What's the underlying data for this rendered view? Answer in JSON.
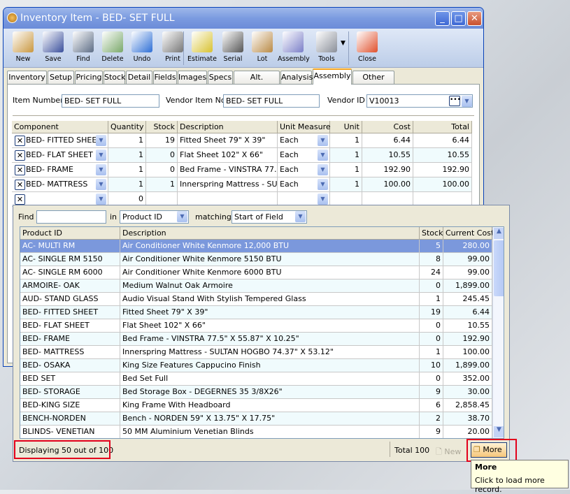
{
  "window": {
    "title": "Inventory Item - BED- SET FULL",
    "controls": [
      "_",
      "□",
      "✕"
    ]
  },
  "toolbar": [
    {
      "label": "New",
      "icon": "new-item-icon",
      "color": "#c9973f"
    },
    {
      "label": "Save",
      "icon": "floppy-disk-icon",
      "color": "#3a4f9c"
    },
    {
      "label": "Find",
      "icon": "binoculars-icon",
      "color": "#5d6d86"
    },
    {
      "label": "Delete",
      "icon": "recycle-bin-icon",
      "color": "#7aa86a"
    },
    {
      "label": "Undo",
      "icon": "undo-arrow-icon",
      "color": "#2e6fd6"
    },
    {
      "label": "Print",
      "icon": "printer-icon",
      "color": "#777777"
    },
    {
      "label": "Estimate",
      "icon": "estimate-icon",
      "color": "#d8c230"
    },
    {
      "label": "Serial",
      "icon": "barcode-icon",
      "color": "#555555"
    },
    {
      "label": "Lot",
      "icon": "lot-box-icon",
      "color": "#b98a45"
    },
    {
      "label": "Assembly",
      "icon": "assembly-icon",
      "color": "#7b7fc8"
    },
    {
      "label": "Tools",
      "icon": "tools-icon",
      "color": "#8a8f99"
    },
    {
      "label": "Close",
      "icon": "close-window-icon",
      "color": "#e0502c"
    }
  ],
  "tabs": [
    "Inventory",
    "Setup",
    "Pricing",
    "Stock",
    "Detail",
    "Fields",
    "Images",
    "Specs",
    "Alt. Vendors",
    "Analysis",
    "Assembly",
    "Other Cost"
  ],
  "active_tab": "Assembly",
  "form": {
    "item_number_label": "Item Number",
    "item_number": "BED- SET FULL",
    "vendor_item_label": "Vendor Item No",
    "vendor_item": "BED- SET FULL",
    "vendor_id_label": "Vendor ID",
    "vendor_id": "V10013"
  },
  "components": {
    "columns": [
      "Component",
      "Quantity",
      "Stock",
      "Description",
      "Unit Measure",
      "Unit",
      "Cost",
      "Total"
    ],
    "rows": [
      [
        "BED- FITTED SHEET",
        "1",
        "19",
        "Fitted Sheet 79\" X 39\"",
        "Each",
        "1",
        "6.44",
        "6.44"
      ],
      [
        "BED- FLAT SHEET",
        "1",
        "0",
        "Flat Sheet 102\" X 66\"",
        "Each",
        "1",
        "10.55",
        "10.55"
      ],
      [
        "BED- FRAME",
        "1",
        "0",
        "Bed Frame - VINSTRA 77.5\" X",
        "Each",
        "1",
        "192.90",
        "192.90"
      ],
      [
        "BED- MATTRESS",
        "1",
        "1",
        "Innerspring Mattress - SULTAN",
        "Each",
        "1",
        "100.00",
        "100.00"
      ],
      [
        "",
        "0",
        "",
        "",
        "",
        "",
        "",
        ""
      ]
    ]
  },
  "lookup": {
    "find_label": "Find",
    "find_value": "",
    "in_label": "in",
    "in_value": "Product ID",
    "matching_label": "matching",
    "matching_value": "Start of Field",
    "columns": [
      "Product ID",
      "Description",
      "Stock",
      "Current Cost"
    ],
    "selected_index": 0,
    "rows": [
      [
        "AC- MULTI RM",
        "Air Conditioner White Kenmore 12,000 BTU",
        "5",
        "280.00"
      ],
      [
        "AC- SINGLE RM 5150",
        "Air Conditioner White Kenmore 5150 BTU",
        "8",
        "99.00"
      ],
      [
        "AC- SINGLE RM 6000",
        "Air Conditioner White Kenmore 6000 BTU",
        "24",
        "99.00"
      ],
      [
        "ARMOIRE- OAK",
        "Medium Walnut Oak Armoire",
        "0",
        "1,899.00"
      ],
      [
        "AUD- STAND GLASS",
        "Audio Visual Stand With Stylish Tempered Glass",
        "1",
        "245.45"
      ],
      [
        "BED- FITTED SHEET",
        "Fitted Sheet 79\" X 39\"",
        "19",
        "6.44"
      ],
      [
        "BED- FLAT SHEET",
        "Flat Sheet 102\" X 66\"",
        "0",
        "10.55"
      ],
      [
        "BED- FRAME",
        "Bed Frame - VINSTRA 77.5\" X 55.87\" X 10.25\"",
        "0",
        "192.90"
      ],
      [
        "BED- MATTRESS",
        "Innerspring Mattress - SULTAN HOGBO 74.37\" X 53.12\"",
        "1",
        "100.00"
      ],
      [
        "BED- OSAKA",
        "King Size Features Cappucino Finish",
        "10",
        "1,899.00"
      ],
      [
        "BED SET",
        "Bed Set Full",
        "0",
        "352.00"
      ],
      [
        "BED- STORAGE",
        "Bed Storage Box - DEGERNES 35 3/8X26\"",
        "9",
        "30.00"
      ],
      [
        "BED-KING SIZE",
        "King Frame With  Headboard",
        "6",
        "2,858.45"
      ],
      [
        "BENCH-NORDEN",
        "Bench - NORDEN 59\" X 13.75\" X 17.75\"",
        "2",
        "38.70"
      ],
      [
        "BLINDS- VENETIAN",
        "50 MM Aluminium Venetian Blinds",
        "9",
        "20.00"
      ]
    ],
    "status": "Displaying 50 out of 100",
    "total": "Total 100",
    "new_label": "New",
    "more_label": "More"
  },
  "tooltip": {
    "title": "More",
    "text": "Click to load more record."
  },
  "colors": {
    "highlight": "#e3001b",
    "selection": "#7b98dc",
    "titlebar": "#7b9be0"
  }
}
